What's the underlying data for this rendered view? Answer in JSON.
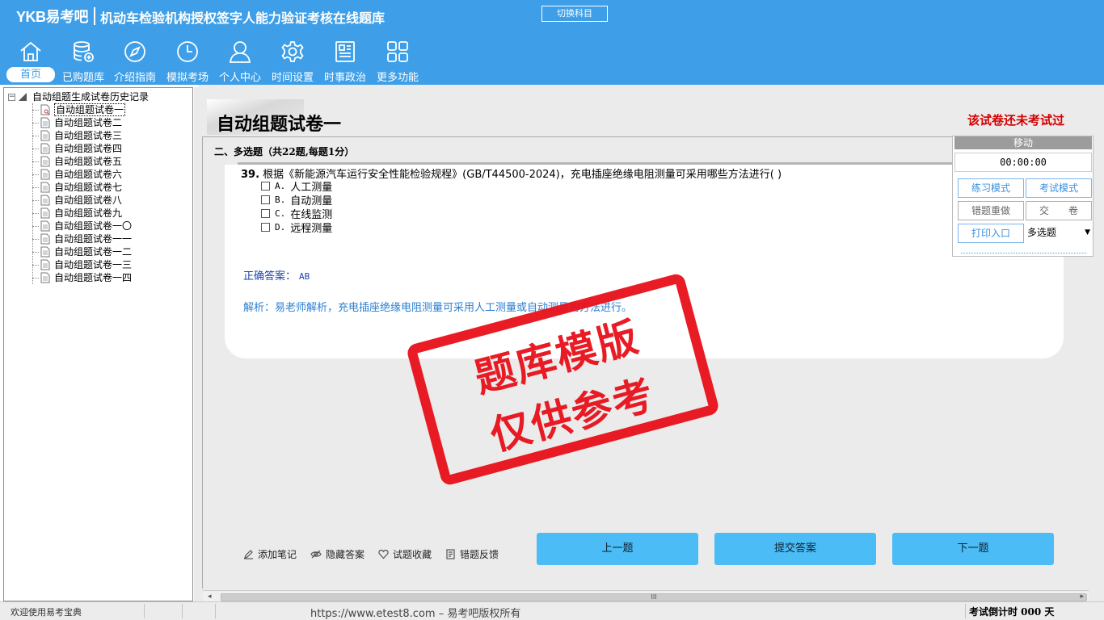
{
  "header": {
    "logo": "YKB易考吧",
    "app_title": "机动车检验机构授权签字人能力验证考核在线题库",
    "switch_label": "切换科目"
  },
  "nav": [
    {
      "label": "首页",
      "icon": "home-icon"
    },
    {
      "label": "已购题库",
      "icon": "database-icon"
    },
    {
      "label": "介绍指南",
      "icon": "compass-icon"
    },
    {
      "label": "模拟考场",
      "icon": "clock-icon"
    },
    {
      "label": "个人中心",
      "icon": "user-icon"
    },
    {
      "label": "时间设置",
      "icon": "gear-icon"
    },
    {
      "label": "时事政治",
      "icon": "news-icon"
    },
    {
      "label": "更多功能",
      "icon": "grid-icon"
    }
  ],
  "tree": {
    "root": "自动组题生成试卷历史记录",
    "items": [
      "自动组题试卷一",
      "自动组题试卷二",
      "自动组题试卷三",
      "自动组题试卷四",
      "自动组题试卷五",
      "自动组题试卷六",
      "自动组题试卷七",
      "自动组题试卷八",
      "自动组题试卷九",
      "自动组题试卷一〇",
      "自动组题试卷一一",
      "自动组题试卷一二",
      "自动组题试卷一三",
      "自动组题试卷一四"
    ]
  },
  "main": {
    "paper_title": "自动组题试卷一",
    "status_text": "该试卷还未考试过",
    "section_title": "二、多选题（共22题,每题1分）",
    "question": {
      "number": "39.",
      "text": "根据《新能源汽车运行安全性能检验规程》(GB/T44500-2024)，充电插座绝缘电阻测量可采用哪些方法进行( )",
      "options": [
        {
          "letter": "A.",
          "text": "人工测量"
        },
        {
          "letter": "B.",
          "text": "自动测量"
        },
        {
          "letter": "C.",
          "text": "在线监测"
        },
        {
          "letter": "D.",
          "text": "远程测量"
        }
      ],
      "answer_label": "正确答案：",
      "answer_value": "AB",
      "explanation": "解析：易老师解析，充电插座绝缘电阻测量可采用人工测量或自动测量的方法进行。"
    },
    "watermark": {
      "line1": "题库模版",
      "line2": "仅供参考"
    },
    "tools": [
      "添加笔记",
      "隐藏答案",
      "试题收藏",
      "错题反馈"
    ],
    "buttons": {
      "prev": "上一题",
      "submit": "提交答案",
      "next": "下一题"
    },
    "scroll_grip": "III"
  },
  "float_panel": {
    "header": "移动",
    "timer": "00:00:00",
    "practice_mode": "练习模式",
    "exam_mode": "考试模式",
    "redo_wrong": "错题重做",
    "hand_in": "交　　卷",
    "print_entry": "打印入口",
    "question_type": "多选题"
  },
  "statusbar": {
    "welcome": "欢迎使用易考宝典",
    "copyright": "https://www.etest8.com – 易考吧版权所有",
    "countdown": "考试倒计时 000 天"
  },
  "colors": {
    "header_bg": "#3e9fe8",
    "button_bg": "#4bbcf5",
    "stamp_red": "#e8101a",
    "answer_blue": "#1a3fb0"
  }
}
